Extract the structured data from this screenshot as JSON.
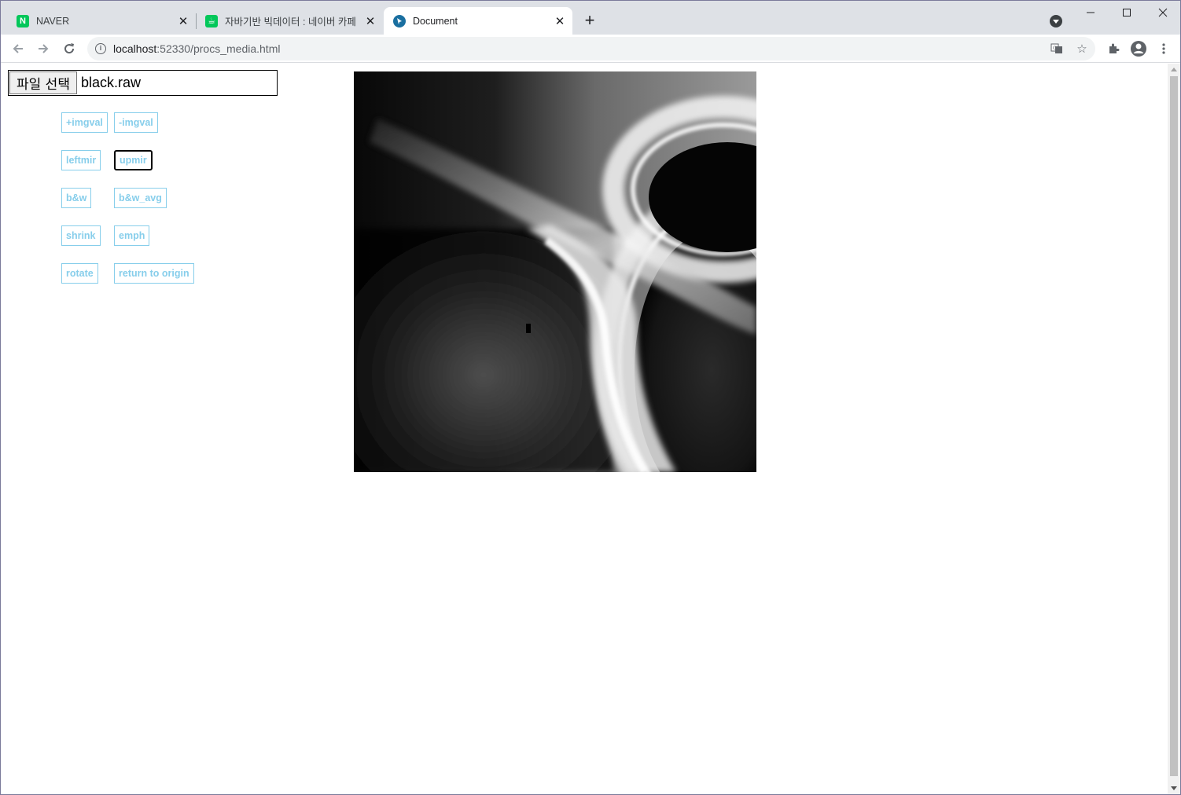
{
  "browser": {
    "tabs": [
      {
        "title": "NAVER",
        "favicon": "N",
        "favicon_color": "#03c75a"
      },
      {
        "title": "자바기반 빅데이터 : 네이버 카페",
        "favicon": "☕",
        "favicon_color": "#03c75a"
      },
      {
        "title": "Document",
        "favicon": "",
        "favicon_color": "#1a6fa0",
        "active": true
      }
    ],
    "url_host": "localhost",
    "url_path": ":52330/procs_media.html"
  },
  "page": {
    "file_button_label": "파일 선택",
    "file_name": "black.raw",
    "buttons": [
      {
        "id": "plus-imgval",
        "label": "+imgval"
      },
      {
        "id": "minus-imgval",
        "label": "-imgval"
      },
      {
        "id": "leftmir",
        "label": "leftmir"
      },
      {
        "id": "upmir",
        "label": "upmir"
      },
      {
        "id": "bw",
        "label": "b&w"
      },
      {
        "id": "bw-avg",
        "label": "b&w_avg"
      },
      {
        "id": "shrink",
        "label": "shrink"
      },
      {
        "id": "emph",
        "label": "emph"
      },
      {
        "id": "rotate",
        "label": "rotate"
      },
      {
        "id": "return-to-origin",
        "label": "return to origin"
      }
    ],
    "canvas_image": "grayscale black hole render",
    "button_color": "#87ceeb"
  }
}
